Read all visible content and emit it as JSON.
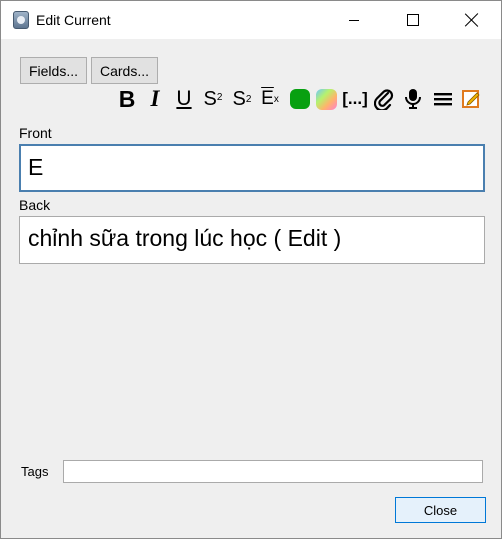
{
  "window": {
    "title": "Edit Current"
  },
  "buttons": {
    "fields": "Fields...",
    "cards": "Cards...",
    "close": "Close"
  },
  "toolbar": {
    "bold": "B",
    "italic": "I",
    "underline": "U",
    "superscript_base": "S",
    "superscript_mark": "2",
    "subscript_base": "S",
    "subscript_mark": "2",
    "clear_base": "E",
    "clear_mark": "x",
    "cloze": "[...]",
    "text_color": "#08a011",
    "icons": [
      "bold-icon",
      "italic-icon",
      "underline-icon",
      "superscript-icon",
      "subscript-icon",
      "clear-formatting-icon",
      "text-color-icon",
      "highlight-color-icon",
      "cloze-icon",
      "paperclip-icon",
      "microphone-icon",
      "menu-icon",
      "html-editor-icon"
    ]
  },
  "fields": {
    "front_label": "Front",
    "front_value": "E",
    "back_label": "Back",
    "back_value": "chỉnh sữa trong lúc học ( Edit )"
  },
  "tags": {
    "label": "Tags",
    "value": ""
  }
}
